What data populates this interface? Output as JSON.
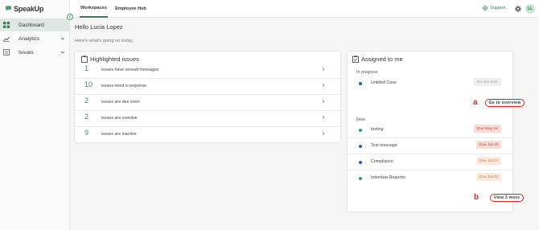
{
  "app": {
    "brand": "SpeakUp"
  },
  "sidebar": {
    "items": [
      {
        "label": "Dashboard",
        "icon": "dashboard-icon",
        "active": true
      },
      {
        "label": "Analytics",
        "icon": "analytics-icon",
        "expandable": true
      },
      {
        "label": "Issues",
        "icon": "issues-icon",
        "expandable": true
      }
    ]
  },
  "topbar": {
    "tabs": [
      {
        "label": "Workspaces",
        "active": true
      },
      {
        "label": "Employee Hub",
        "active": false
      }
    ],
    "support_label": "Support",
    "avatar_initials": "LL"
  },
  "greeting": {
    "title": "Hello Lucia Lopez",
    "subtitle": "Here's what's going on today."
  },
  "highlighted": {
    "title": "Highlighted issues",
    "rows": [
      {
        "count": "1",
        "text": "issues have unread messages"
      },
      {
        "count": "10",
        "text": "issues need a response"
      },
      {
        "count": "2",
        "text": "issues are due soon"
      },
      {
        "count": "2",
        "text": "issues are overdue"
      },
      {
        "count": "9",
        "text": "issues are inactive"
      }
    ]
  },
  "assigned": {
    "title": "Assigned to me",
    "in_progress_label": "In progress",
    "in_progress": [
      {
        "name": "Untitled Case",
        "due": "No due date",
        "due_style": "none",
        "dot_color": "#1f5fc9"
      }
    ],
    "go_overview_label": "Go to overview",
    "marker_a": "a",
    "new_label": "New",
    "new": [
      {
        "name": "testing",
        "due": "Due May-16",
        "due_style": "red",
        "dot_color": "#2e9e5b"
      },
      {
        "name": "Test message",
        "due": "Due Jul-18",
        "due_style": "red",
        "dot_color": "#1f5fc9"
      },
      {
        "name": "Compliance",
        "due": "Due Jul-23",
        "due_style": "orange",
        "dot_color": "#1f5fc9"
      },
      {
        "name": "Interview Reporter",
        "due": "Due Jul-25",
        "due_style": "orange",
        "dot_color": "#2e9e5b"
      }
    ],
    "view_more_label": "View 3 more",
    "marker_b": "b"
  },
  "colors": {
    "accent": "#3d7a56",
    "highlight_red": "#dd2222"
  }
}
